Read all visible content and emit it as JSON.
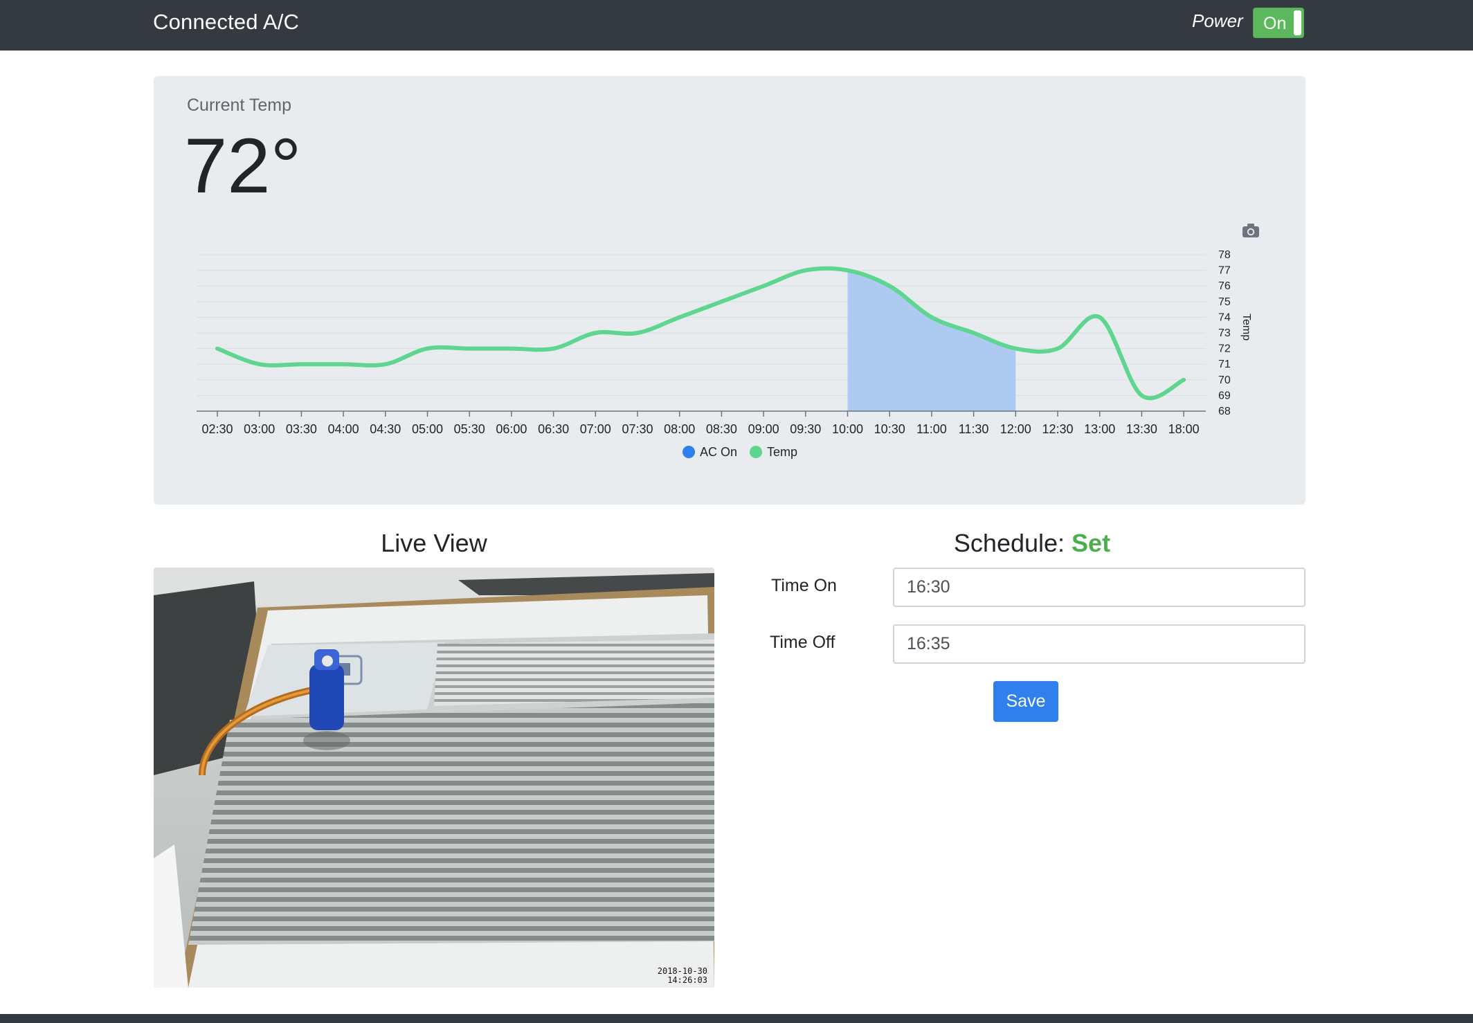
{
  "navbar": {
    "brand": "Connected A/C",
    "power_label": "Power",
    "power_toggle": "On"
  },
  "current_temp": {
    "label": "Current Temp",
    "value": "72°"
  },
  "chart_data": {
    "type": "line",
    "categories": [
      "02:30",
      "03:00",
      "03:30",
      "04:00",
      "04:30",
      "05:00",
      "05:30",
      "06:00",
      "06:30",
      "07:00",
      "07:30",
      "08:00",
      "08:30",
      "09:00",
      "09:30",
      "10:00",
      "10:30",
      "11:00",
      "11:30",
      "12:00",
      "12:30",
      "13:00",
      "13:30",
      "18:00"
    ],
    "series": [
      {
        "name": "AC On",
        "type": "area",
        "x_range": [
          "10:00",
          "12:00"
        ],
        "color": "#aac9f0"
      },
      {
        "name": "Temp",
        "values": [
          72,
          71,
          71,
          71,
          71,
          72,
          72,
          72,
          72,
          73,
          73,
          74,
          75,
          76,
          77,
          77,
          76,
          74,
          73,
          72,
          72,
          74,
          69,
          70
        ],
        "color": "#5fd68f"
      }
    ],
    "ylabel": "Temp",
    "yticks": [
      68,
      69,
      70,
      71,
      72,
      73,
      74,
      75,
      76,
      77,
      78
    ],
    "ylim": [
      68,
      78
    ],
    "y_axis_side": "right",
    "legend": {
      "position": "bottom",
      "items": [
        {
          "label": "AC On",
          "color": "#2f80ed"
        },
        {
          "label": "Temp",
          "color": "#5fd68f"
        }
      ]
    },
    "grid": true
  },
  "live_view": {
    "title": "Live View",
    "timestamp_line1": "2018-10-30",
    "timestamp_line2": "14:26:03"
  },
  "schedule": {
    "title": "Schedule:",
    "status": "Set",
    "time_on_label": "Time On",
    "time_on_value": "16:30",
    "time_off_label": "Time Off",
    "time_off_value": "16:35",
    "save_label": "Save"
  }
}
